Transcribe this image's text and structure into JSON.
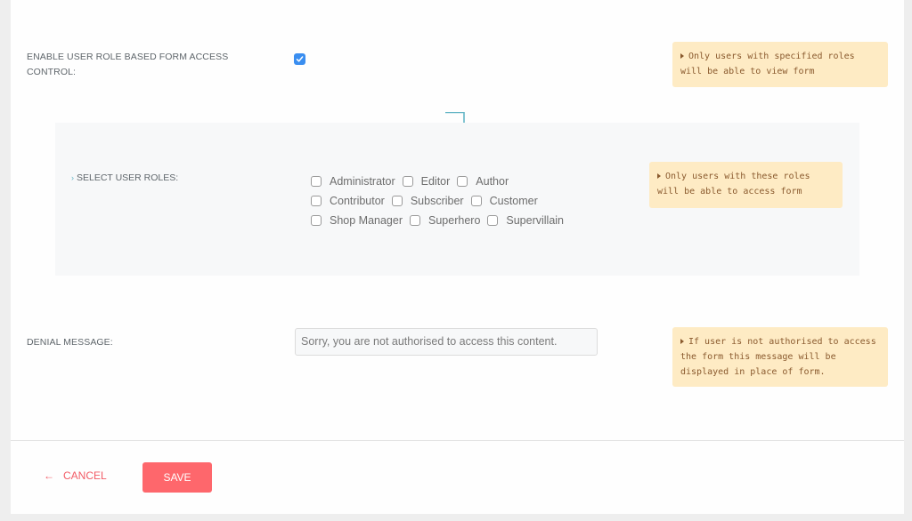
{
  "access_control": {
    "label": "Enable user role based form access",
    "label_line2": "control:",
    "checked": true,
    "hint": "Only users with specified roles will be able to view form"
  },
  "roles": {
    "label": "Select user roles:",
    "hint": "Only users with these roles will be able to access form",
    "items": [
      {
        "label": "Administrator",
        "checked": false
      },
      {
        "label": "Editor",
        "checked": false
      },
      {
        "label": "Author",
        "checked": false
      },
      {
        "label": "Contributor",
        "checked": false
      },
      {
        "label": "Subscriber",
        "checked": false
      },
      {
        "label": "Customer",
        "checked": false
      },
      {
        "label": "Shop Manager",
        "checked": false
      },
      {
        "label": "Superhero",
        "checked": false
      },
      {
        "label": "Supervillain",
        "checked": false
      }
    ]
  },
  "denial": {
    "label": "Denial message:",
    "value": "Sorry, you are not authorised to access this content.",
    "hint": "If user is not authorised to access the form this message will be displayed in place of form."
  },
  "footer": {
    "cancel_label": "Cancel",
    "save_label": "Save"
  },
  "colors": {
    "accent": "#fe676c",
    "checkbox": "#3a8ef0",
    "hint_bg": "#feebc4",
    "arrow": "#64b5c6"
  }
}
